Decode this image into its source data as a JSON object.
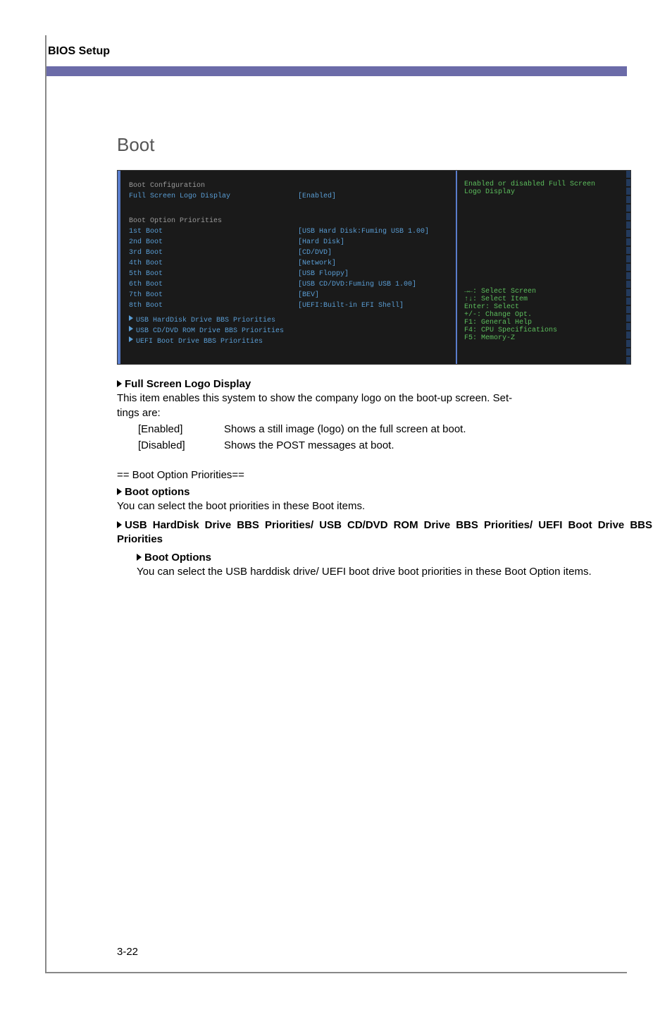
{
  "doc": {
    "header_title": "BIOS Setup",
    "section_title": "Boot",
    "page_number": "3-22"
  },
  "bios": {
    "left": {
      "config_header": "Boot Configuration",
      "logo_label": "Full Screen Logo Display",
      "logo_value": "[Enabled]",
      "priorities_header": "Boot Option Priorities",
      "items": [
        {
          "label": "1st Boot",
          "value": "[USB Hard Disk:Fuming USB 1.00]"
        },
        {
          "label": "2nd Boot",
          "value": "[Hard Disk]"
        },
        {
          "label": "3rd Boot",
          "value": "[CD/DVD]"
        },
        {
          "label": "4th Boot",
          "value": "[Network]"
        },
        {
          "label": "5th Boot",
          "value": "[USB Floppy]"
        },
        {
          "label": "6th Boot",
          "value": "[USB CD/DVD:Fuming USB 1.00]"
        },
        {
          "label": "7th Boot",
          "value": "[BEV]"
        },
        {
          "label": "8th Boot",
          "value": "[UEFI:Built-in EFI Shell]"
        }
      ],
      "sub1": "USB HardDisk Drive BBS Priorities",
      "sub2": "USB CD/DVD ROM Drive BBS Priorities",
      "sub3": "UEFI Boot Drive BBS Priorities"
    },
    "right": {
      "help1": "Enabled or disabled Full Screen",
      "help2": "Logo Display",
      "k1": "→←: Select Screen",
      "k2": "↑↓: Select Item",
      "k3": "Enter: Select",
      "k4": "+/-: Change Opt.",
      "k5": "F1: General Help",
      "k6": "F4: CPU Specifications",
      "k7": "F5: Memory-Z"
    }
  },
  "body": {
    "h1": "Full Screen Logo Display",
    "p1a": "This item enables this system to show the company logo on the boot-up screen. Set",
    "p1b": "tings are:",
    "opt_en_l": "[Enabled]",
    "opt_en_v": "Shows a still image (logo) on the full screen at boot.",
    "opt_di_l": "[Disabled]",
    "opt_di_v": "Shows the POST messages at boot.",
    "sec2": "== Boot Option Priorities==",
    "h2": "Boot options",
    "p2": "You can select the boot priorities in these Boot items.",
    "h3": "USB HardDisk Drive BBS Priorities/ USB CD/DVD ROM Drive BBS Priorities/ UEFI Boot Drive BBS Priorities",
    "h4": "Boot Options",
    "p4": "You can select the USB harddisk drive/ UEFI boot drive boot priorities in these Boot Option items."
  }
}
